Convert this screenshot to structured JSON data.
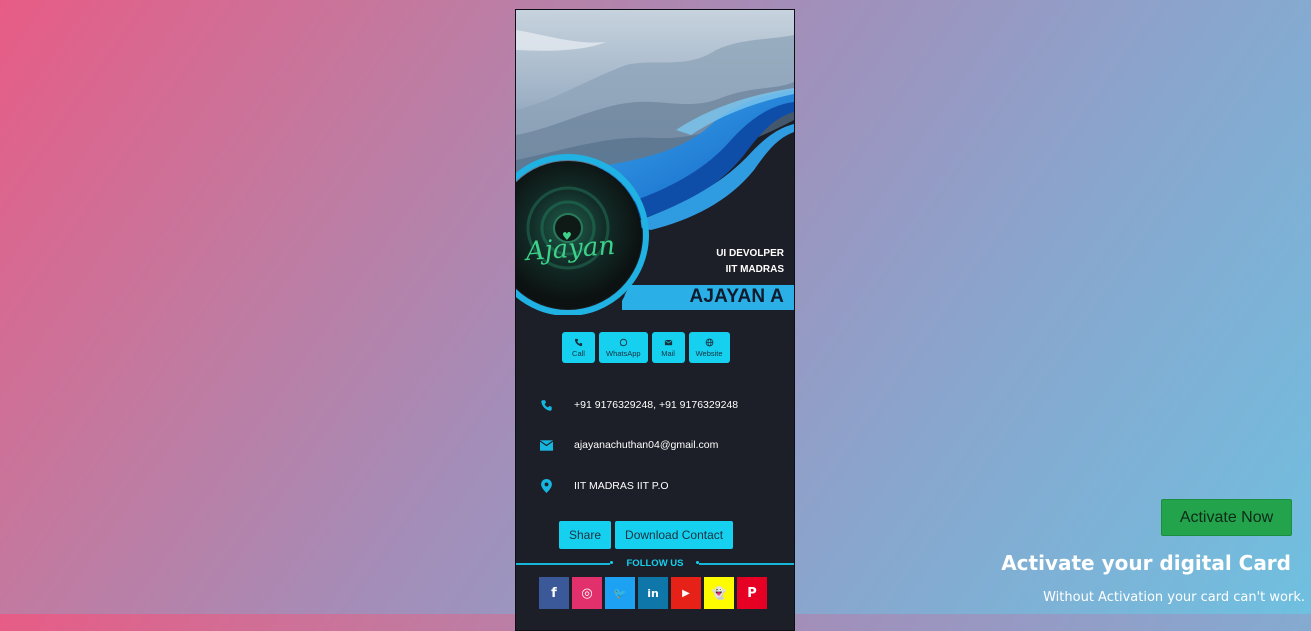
{
  "card": {
    "role": "UI DEVOLPER",
    "org": "IIT MADRAS",
    "name": "AJAYAN A",
    "logo_signature": "Ajayan"
  },
  "quick_actions": [
    {
      "label": "Call",
      "icon": "phone-icon"
    },
    {
      "label": "WhatsApp",
      "icon": "whatsapp-icon"
    },
    {
      "label": "Mail",
      "icon": "mail-icon"
    },
    {
      "label": "Website",
      "icon": "globe-icon"
    }
  ],
  "contact": {
    "phone": "+91 9176329248, +91 9176329248",
    "email": "ajayanachuthan04@gmail.com",
    "address": "IIT MADRAS IIT P.O"
  },
  "buttons": {
    "share": "Share",
    "download": "Download Contact"
  },
  "follow": {
    "label": "FOLLOW US",
    "socials": [
      {
        "icon": "facebook-icon",
        "glyph": "f",
        "color": "#3b5998"
      },
      {
        "icon": "instagram-icon",
        "glyph": "◎",
        "color": "#e1306c"
      },
      {
        "icon": "twitter-icon",
        "glyph": "🐦",
        "color": "#1da1f2"
      },
      {
        "icon": "linkedin-icon",
        "glyph": "in",
        "color": "#0e76a8"
      },
      {
        "icon": "youtube-icon",
        "glyph": "▶",
        "color": "#e62117"
      },
      {
        "icon": "snapchat-icon",
        "glyph": "👻",
        "color": "#fffc00"
      },
      {
        "icon": "pinterest-icon",
        "glyph": "P",
        "color": "#e60023"
      }
    ]
  },
  "activation": {
    "button": "Activate Now",
    "title": "Activate your digital Card",
    "subtitle": "Without Activation your card can't work."
  },
  "colors": {
    "accent": "#16d0ef",
    "card_bg": "#1c1f27",
    "activate_green": "#23a34c"
  }
}
